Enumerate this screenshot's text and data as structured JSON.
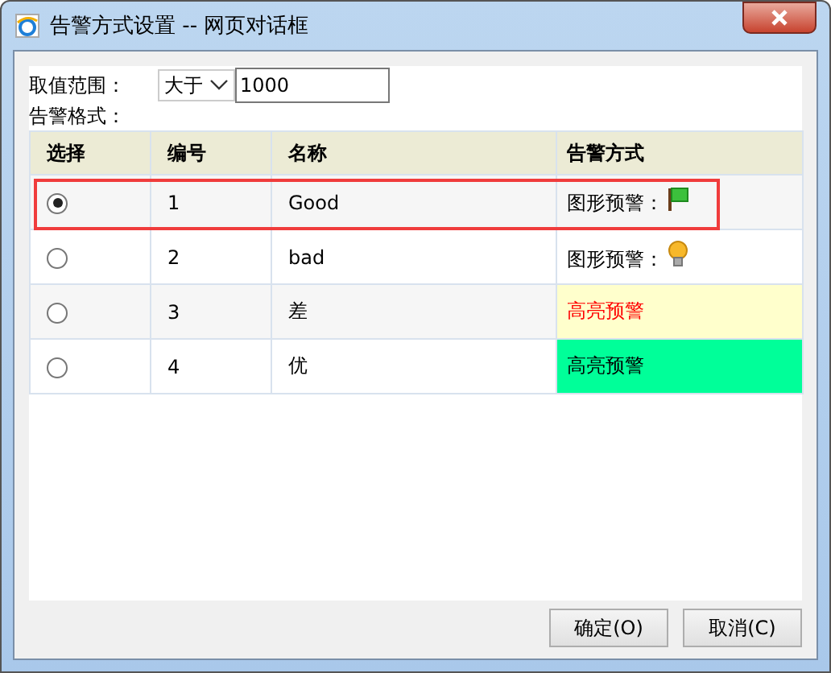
{
  "window": {
    "title": "告警方式设置 -- 网页对话框"
  },
  "range": {
    "label": "取值范围：",
    "operator": "大于",
    "value": "1000"
  },
  "format_label": "告警格式：",
  "table": {
    "columns": [
      "选择",
      "编号",
      "名称",
      "告警方式"
    ],
    "rows": [
      {
        "selected": true,
        "outlined": true,
        "number": "1",
        "name": "Good",
        "alarm": {
          "kind": "flag",
          "text": "图形预警："
        }
      },
      {
        "selected": false,
        "outlined": false,
        "number": "2",
        "name": "bad",
        "alarm": {
          "kind": "bulb",
          "text": "图形预警："
        }
      },
      {
        "selected": false,
        "outlined": false,
        "number": "3",
        "name": "差",
        "alarm": {
          "kind": "highlight",
          "text": "高亮预警",
          "color": "#ffffcc",
          "red_text": true
        }
      },
      {
        "selected": false,
        "outlined": false,
        "number": "4",
        "name": "优",
        "alarm": {
          "kind": "highlight",
          "text": "高亮预警",
          "color": "#00ff99",
          "red_text": false
        }
      }
    ]
  },
  "buttons": [
    "确定(O)",
    "取消(C)"
  ]
}
